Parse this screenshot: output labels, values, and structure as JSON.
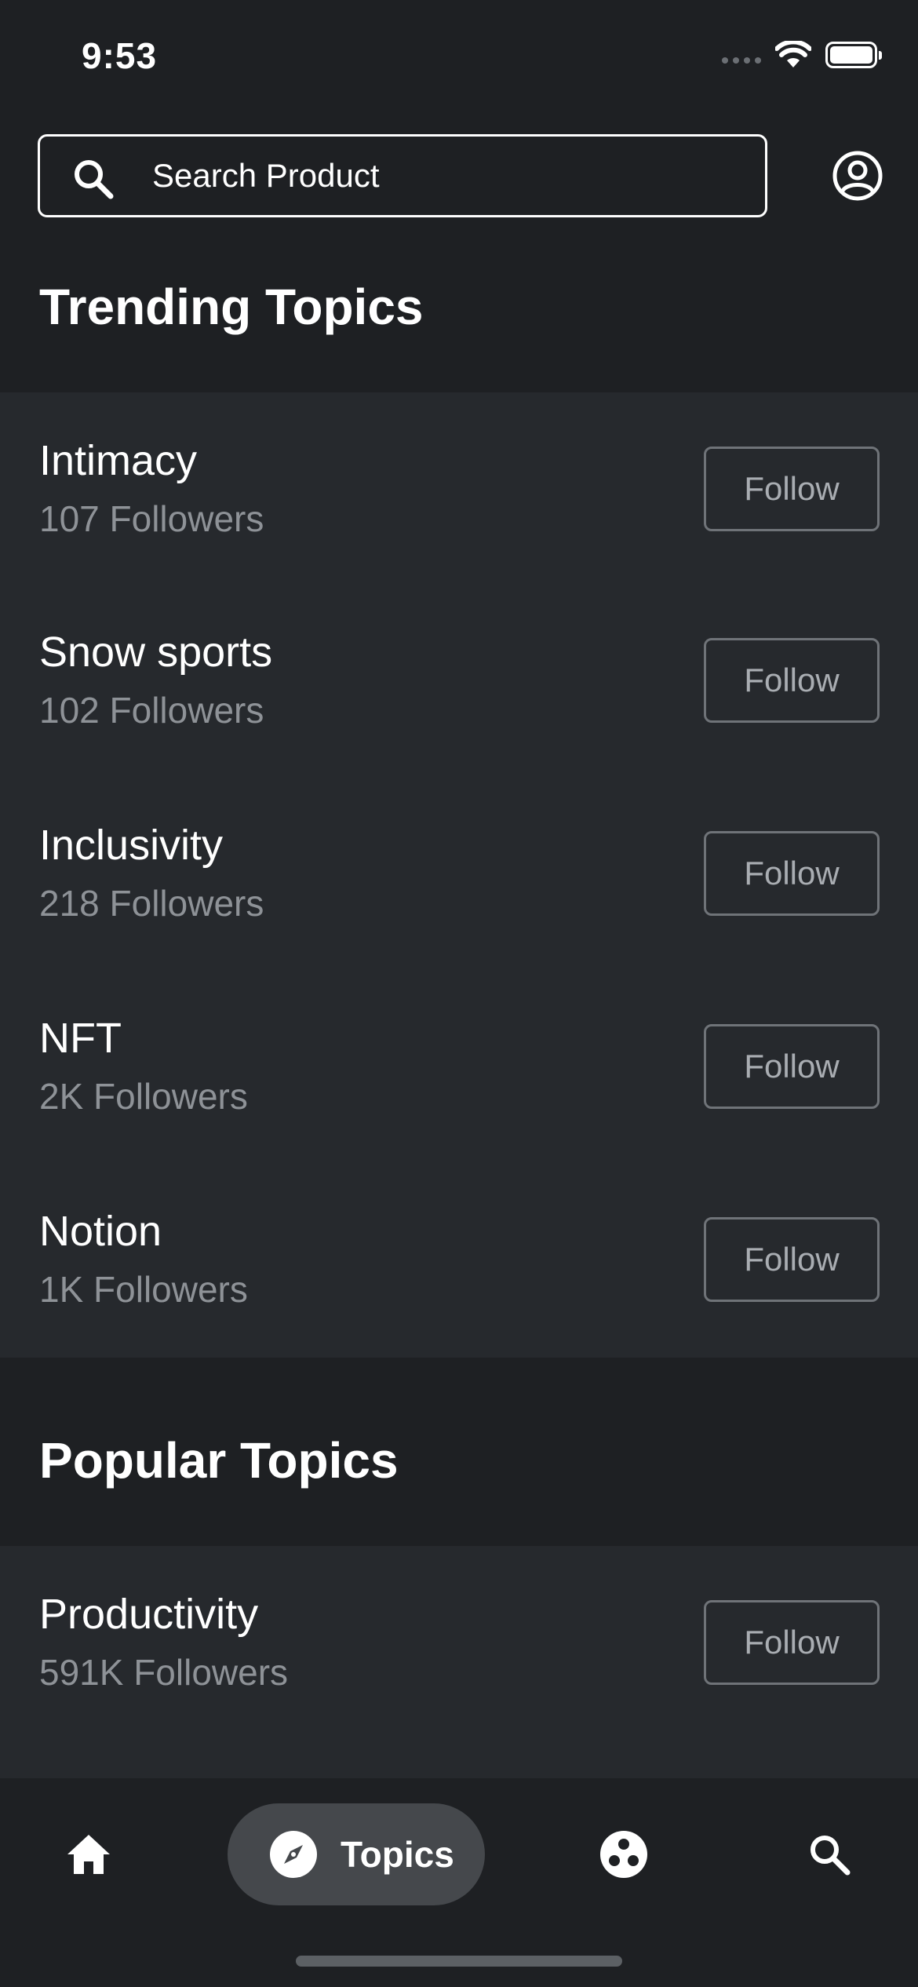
{
  "status_bar": {
    "time": "9:53"
  },
  "search": {
    "placeholder": "Search Product"
  },
  "sections": {
    "trending": {
      "title": "Trending Topics",
      "topics": [
        {
          "name": "Intimacy",
          "followers": "107 Followers",
          "button": "Follow"
        },
        {
          "name": "Snow sports",
          "followers": "102 Followers",
          "button": "Follow"
        },
        {
          "name": "Inclusivity",
          "followers": "218 Followers",
          "button": "Follow"
        },
        {
          "name": "NFT",
          "followers": "2K Followers",
          "button": "Follow"
        },
        {
          "name": "Notion",
          "followers": "1K Followers",
          "button": "Follow"
        }
      ]
    },
    "popular": {
      "title": "Popular Topics",
      "topics": [
        {
          "name": "Productivity",
          "followers": "591K Followers",
          "button": "Follow"
        }
      ]
    }
  },
  "bottom_nav": {
    "items": [
      {
        "icon": "home-icon",
        "label": ""
      },
      {
        "icon": "compass-icon",
        "label": "Topics",
        "active": true
      },
      {
        "icon": "community-icon",
        "label": ""
      },
      {
        "icon": "search-icon",
        "label": ""
      }
    ]
  },
  "colors": {
    "background": "#1e2023",
    "list_background": "#26292d",
    "secondary_text": "#8e9297",
    "button_border": "#6f7378",
    "active_pill": "#45484c"
  }
}
